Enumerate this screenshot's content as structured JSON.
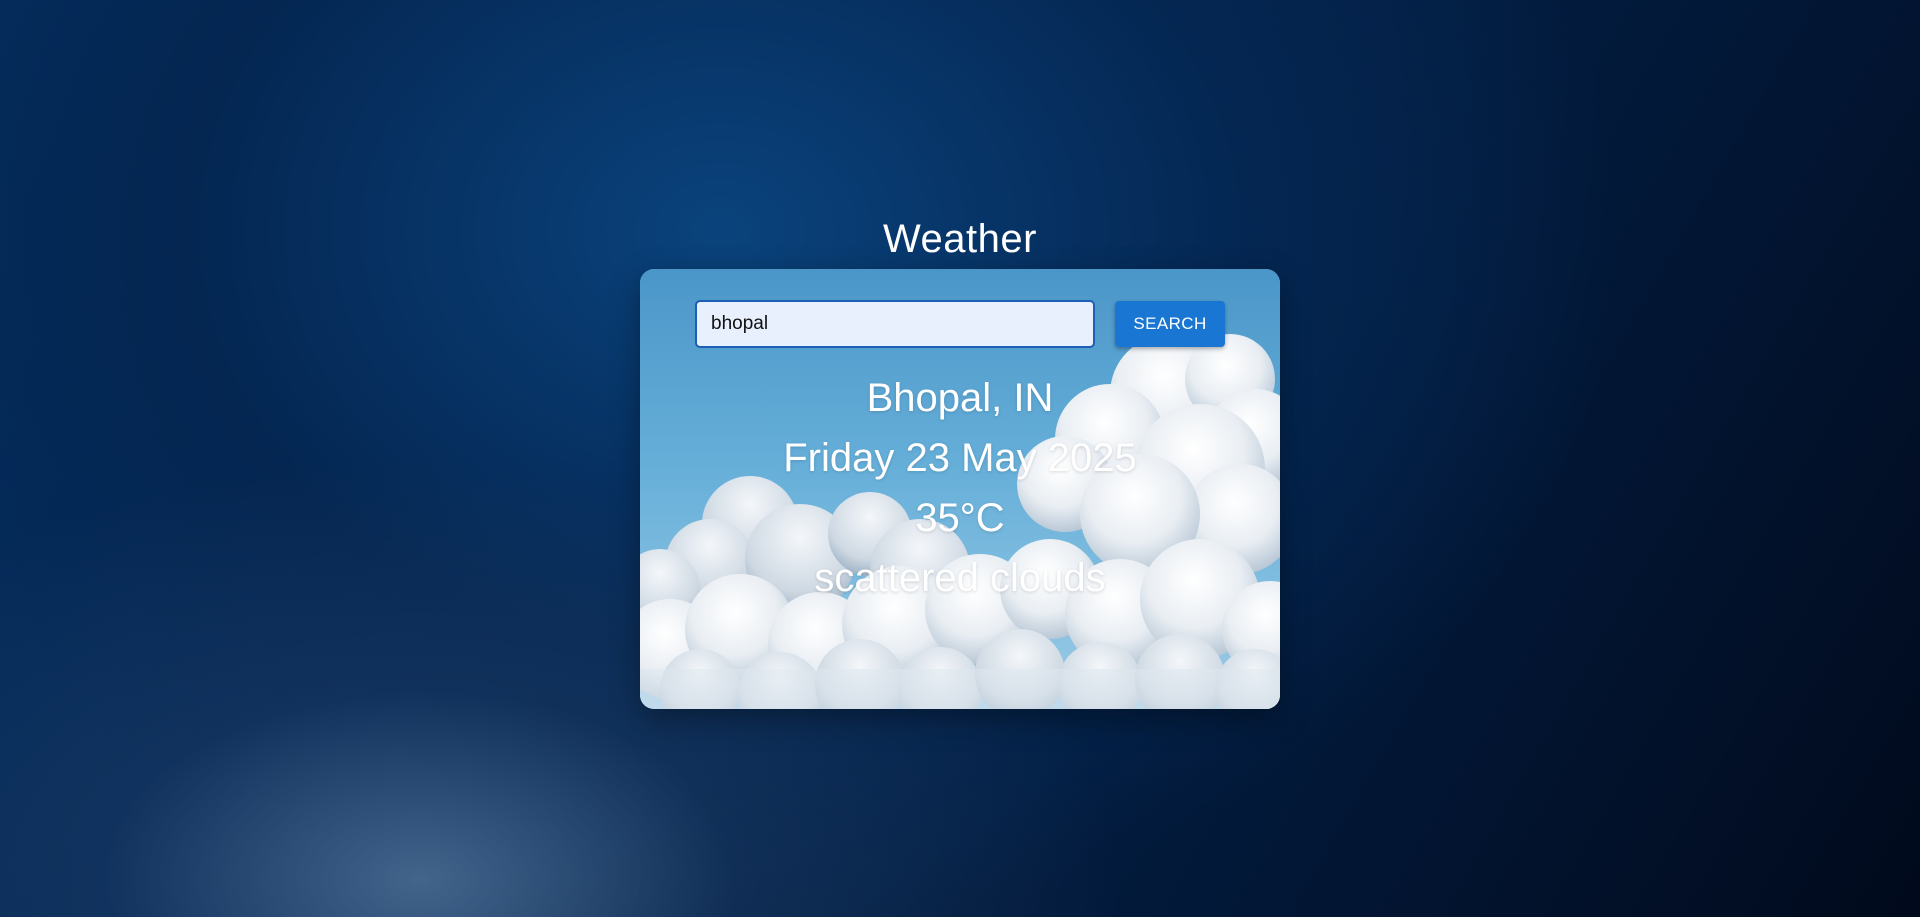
{
  "app": {
    "title": "Weather"
  },
  "search": {
    "value": "bhopal",
    "button_label": "SEARCH"
  },
  "weather": {
    "location": "Bhopal, IN",
    "date": "Friday 23 May 2025",
    "temperature": "35°C",
    "description": "scattered clouds"
  },
  "colors": {
    "button": "#1976d2",
    "input_bg": "#e8f0fe",
    "input_border": "#1d5fb5",
    "text": "#ffffff"
  },
  "icons": {
    "card_background": "cloudy-sky-image"
  }
}
